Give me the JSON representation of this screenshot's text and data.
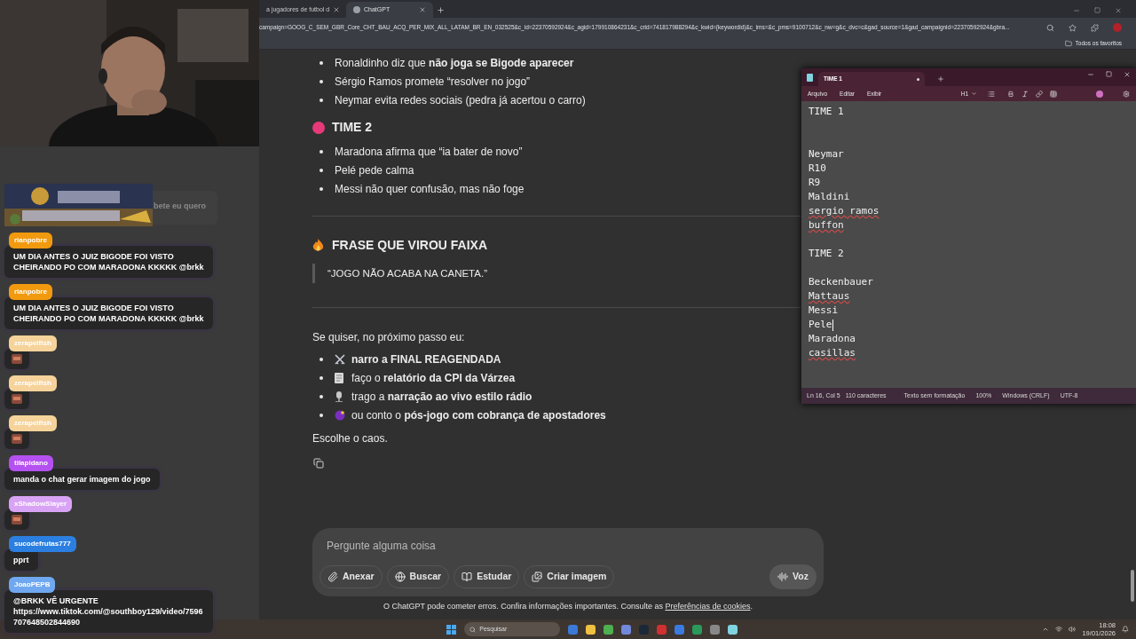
{
  "browser": {
    "tabs": [
      {
        "label": "a jugadores de futbol d",
        "selected": false
      },
      {
        "label": "ChatGPT",
        "selected": true
      }
    ],
    "url": "campaign=GOOG_C_SEM_GBR_Core_CHT_BAU_ACQ_PER_MIX_ALL_LATAM_BR_EN_032525&c_id=22370592924&c_agid=179910864231&c_crid=741817988294&c_kwid={keywordid}&c_ims=&c_pms=9100712&c_nw=g&c_dvc=c&gad_source=1&gad_campaignid=22370592924&gbra...",
    "bookmarks": "Todos os favoritos"
  },
  "chat_overlay": {
    "partial_message": "bete eu quero",
    "messages": [
      {
        "user": "rianpobre",
        "color": "#f29a0f",
        "kind": "text",
        "text": "UM DIA ANTES O JUIZ BIGODE FOI VISTO CHEIRANDO PO COM MARADONA KKKKK @brkk"
      },
      {
        "user": "rianpobre",
        "color": "#f29a0f",
        "kind": "text",
        "text": "UM DIA ANTES O JUIZ BIGODE FOI VISTO CHEIRANDO PO COM MARADONA KKKKK @brkk"
      },
      {
        "user": "zerapelfish",
        "color": "#f5d39a",
        "kind": "emote"
      },
      {
        "user": "zerapelfish",
        "color": "#f5d39a",
        "kind": "emote"
      },
      {
        "user": "zerapelfish",
        "color": "#f5d39a",
        "kind": "emote"
      },
      {
        "user": "tilapidano",
        "color": "#b551f0",
        "kind": "text",
        "text": "manda o chat gerar imagem do jogo"
      },
      {
        "user": "xShadowSlayer",
        "color": "#d9a3f5",
        "kind": "emote"
      },
      {
        "user": "sucodefrutas777",
        "color": "#2b7fe0",
        "kind": "text",
        "text": "pprt"
      },
      {
        "user": "JoaoPEPB",
        "color": "#6fa8f0",
        "kind": "text",
        "text": "@BRKK VÊ URGENTE https://www.tiktok.com/@southboy129/video/7596707648502844690"
      }
    ]
  },
  "article": {
    "list_1": [
      "Ronaldinho diz que **não joga se Bigode aparecer**",
      "Sérgio Ramos promete “resolver no jogo”",
      "Neymar evita redes sociais (pedra já acertou o carro)"
    ],
    "team_2": {
      "heading": "TIME 2",
      "items": [
        "Maradona afirma que “ia bater de novo”",
        "Pelé pede calma",
        "Messi não quer confusão, mas não foge"
      ]
    },
    "banner": {
      "heading": "FRASE QUE VIROU FAIXA",
      "quote": "“JOGO NÃO ACABA NA CANETA.”"
    },
    "intro": "Se quiser, no próximo passo eu:",
    "options": [
      "**narro a FINAL REAGENDADA**",
      "faço o **relatório da CPI da Várzea**",
      "trago a **narração ao vivo estilo rádio**",
      "ou conto o **pós-jogo com cobrança de apostadores**"
    ],
    "closing": "Escolhe o caos."
  },
  "composer": {
    "placeholder": "Pergunte alguma coisa",
    "tools": [
      "Anexar",
      "Buscar",
      "Estudar",
      "Criar imagem"
    ],
    "voice": "Voz"
  },
  "disclaimer": {
    "text": "O ChatGPT pode cometer erros. Confira informações importantes. Consulte as ",
    "link": "Preferências de cookies",
    "after": "."
  },
  "notepad": {
    "tab": {
      "title": "TIME 1",
      "unsaved": true
    },
    "menu": [
      "Arquivo",
      "Editar",
      "Exibir"
    ],
    "heading_style": "H1",
    "lines": [
      {
        "kind": "text",
        "text": "TIME 1",
        "underline": false,
        "caret": false
      },
      {
        "kind": "blank"
      },
      {
        "kind": "blank"
      },
      {
        "kind": "text",
        "text": "Neymar",
        "underline": false,
        "caret": false
      },
      {
        "kind": "text",
        "text": "R10",
        "underline": false,
        "caret": false
      },
      {
        "kind": "text",
        "text": "R9",
        "underline": false,
        "caret": false
      },
      {
        "kind": "text",
        "text": "Maldini",
        "underline": false,
        "caret": false
      },
      {
        "kind": "text",
        "text": "sergio ramos",
        "underline": true,
        "caret": false
      },
      {
        "kind": "text",
        "text": "buffon",
        "underline": true,
        "caret": false
      },
      {
        "kind": "blank"
      },
      {
        "kind": "text",
        "text": "TIME 2",
        "underline": false,
        "caret": false
      },
      {
        "kind": "blank"
      },
      {
        "kind": "text",
        "text": "Beckenbauer",
        "underline": false,
        "caret": false
      },
      {
        "kind": "text",
        "text": "Mattaus",
        "underline": true,
        "caret": false
      },
      {
        "kind": "text",
        "text": "Messi",
        "underline": false,
        "caret": false
      },
      {
        "kind": "text",
        "text": "Pele",
        "underline": false,
        "caret": true
      },
      {
        "kind": "text",
        "text": "Maradona",
        "underline": false,
        "caret": false
      },
      {
        "kind": "text",
        "text": "casillas",
        "underline": true,
        "caret": false
      }
    ],
    "status": [
      "Ln 16, Col 5",
      "110 caracteres",
      "Texto sem formatação",
      "100%",
      "Windows (CRLF)",
      "UTF-8"
    ]
  },
  "taskbar": {
    "search": "Pesquisar",
    "time": "18:08",
    "date": "19/01/2026"
  }
}
